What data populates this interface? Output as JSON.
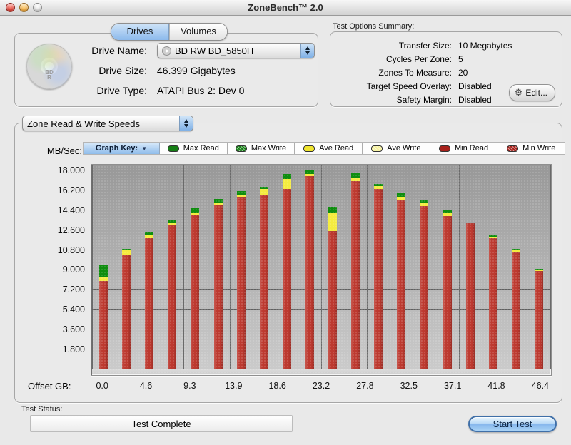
{
  "window": {
    "title": "ZoneBench™ 2.0"
  },
  "tabs": [
    {
      "label": "Drives",
      "active": true
    },
    {
      "label": "Volumes",
      "active": false
    }
  ],
  "drive_panel": {
    "disc_text": "BD R",
    "name_label": "Drive Name:",
    "name_value": "BD RW BD_5850H",
    "size_label": "Drive Size:",
    "size_value": "46.399 Gigabytes",
    "type_label": "Drive Type:",
    "type_value": "ATAPI Bus 2: Dev 0"
  },
  "test_options": {
    "title": "Test Options Summary:",
    "rows": [
      {
        "label": "Transfer Size:",
        "value": "10 Megabytes"
      },
      {
        "label": "Cycles Per Zone:",
        "value": "5"
      },
      {
        "label": "Zones To Measure:",
        "value": "20"
      },
      {
        "label": "Target Speed Overlay:",
        "value": "Disabled"
      },
      {
        "label": "Safety Margin:",
        "value": "Disabled"
      }
    ],
    "edit_button": "Edit..."
  },
  "chart_section": {
    "mode_select_value": "Zone Read & Write Speeds",
    "graph_key_label": "Graph Key:",
    "legend": [
      {
        "label": "Max Read",
        "color": "#157f15",
        "pattern": false
      },
      {
        "label": "Max Write",
        "color": "#157f15",
        "pattern": true
      },
      {
        "label": "Ave Read",
        "color": "#f0e52e",
        "pattern": false
      },
      {
        "label": "Ave Write",
        "color": "#f6f29b",
        "pattern": true
      },
      {
        "label": "Min Read",
        "color": "#a8211b",
        "pattern": false
      },
      {
        "label": "Min Write",
        "color": "#a8211b",
        "pattern": true
      }
    ],
    "y_axis_title": "MB/Sec:",
    "x_axis_title": "Offset GB:"
  },
  "chart_data": {
    "type": "bar",
    "stacked": true,
    "title": "Zone Read & Write Speeds",
    "ylabel": "MB/Sec",
    "xlabel": "Offset GB",
    "ylim": [
      0,
      18.45
    ],
    "grid": true,
    "legend_position": "top",
    "ytick_values": [
      1.8,
      3.6,
      5.4,
      7.2,
      9.0,
      10.8,
      12.6,
      14.4,
      16.2,
      18.0
    ],
    "ytick_labels": [
      "1.800",
      "3.600",
      "5.400",
      "7.200",
      "9.000",
      "10.800",
      "12.600",
      "14.400",
      "16.200",
      "18.000"
    ],
    "dashed_gridlines": [
      9.0,
      10.8,
      18.0
    ],
    "x_tick_labels": [
      "0.0",
      "4.6",
      "9.3",
      "13.9",
      "18.6",
      "23.2",
      "27.8",
      "32.5",
      "37.1",
      "41.8",
      "46.4"
    ],
    "value_encoding": "cumulative segment top in MB/sec per zone (Min Read bottom, Ave Read middle, Max Read cap)",
    "series": [
      {
        "name": "Min Read",
        "color": "#bd3a30",
        "values": [
          8.0,
          10.4,
          11.9,
          13.0,
          14.0,
          14.9,
          15.6,
          15.8,
          16.3,
          17.5,
          12.5,
          17.0,
          16.3,
          15.3,
          14.8,
          13.9,
          13.2,
          11.9,
          10.6,
          8.9
        ]
      },
      {
        "name": "Ave Read",
        "color": "#f4ec3f",
        "values": [
          8.4,
          10.8,
          12.1,
          13.2,
          14.2,
          15.1,
          15.8,
          16.3,
          17.2,
          17.7,
          14.1,
          17.3,
          16.6,
          15.6,
          15.1,
          14.1,
          13.2,
          12.0,
          10.8,
          9.05
        ]
      },
      {
        "name": "Max Read",
        "color": "#0f8d0f",
        "values": [
          9.4,
          10.9,
          12.4,
          13.5,
          14.6,
          15.4,
          16.1,
          16.5,
          17.7,
          18.0,
          14.7,
          17.8,
          16.8,
          16.0,
          15.3,
          14.4,
          13.2,
          12.2,
          10.9,
          9.1
        ]
      }
    ]
  },
  "status": {
    "label": "Test Status:",
    "value": "Test Complete"
  },
  "start_button": "Start Test"
}
